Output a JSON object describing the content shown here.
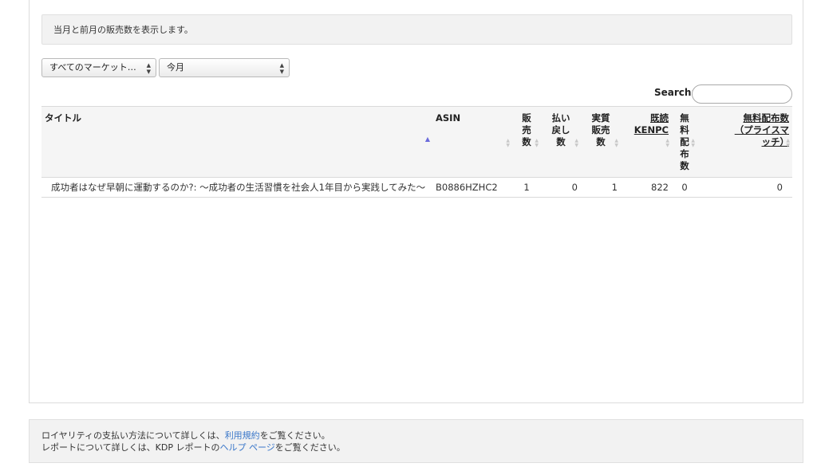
{
  "info": {
    "text": "当月と前月の販売数を表示します。"
  },
  "filters": {
    "market": "すべてのマーケット…",
    "period": "今月"
  },
  "search": {
    "label": "Search:",
    "value": ""
  },
  "table": {
    "headers": {
      "title": "タイトル",
      "asin": "ASIN",
      "sold": "販売数",
      "refunds": "払い戻し数",
      "net": "実質販売数",
      "kenpc": "既読 KENPC",
      "free": "無料配布数",
      "price_match": "無料配布数（プライスマッチ）"
    },
    "rows": [
      {
        "title": "成功者はなぜ早朝に運動するのか?: 〜成功者の生活習慣を社会人1年目から実践してみた〜",
        "asin": "B0886HZHC2",
        "sold": "1",
        "refunds": "0",
        "net": "1",
        "kenpc": "822",
        "free": "0",
        "price_match": "0"
      }
    ]
  },
  "footer": {
    "line1_prefix": "ロイヤリティの支払い方法について詳しくは、",
    "line1_link": "利用規約",
    "line1_suffix": "をご覧ください。",
    "line2_prefix": "レポートについて詳しくは、KDP レポートの",
    "line2_link": "ヘルプ ページ",
    "line2_suffix": "をご覧ください。"
  }
}
